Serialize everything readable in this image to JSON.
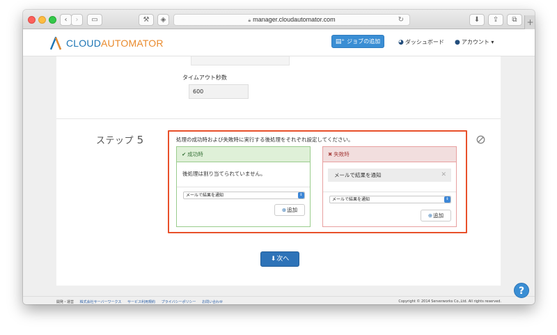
{
  "browser": {
    "url": "manager.cloudautomator.com"
  },
  "header": {
    "logo_part1": "CLOUD",
    "logo_part2": "AUTOMATOR",
    "add_job": "ジョブの追加",
    "dashboard": "ダッシュボード",
    "account": "アカウント ▾"
  },
  "form": {
    "timeout_label": "タイムアウト秒数",
    "timeout_value": "600"
  },
  "step": {
    "label_prefix": "ステップ",
    "label_number": "5",
    "description": "処理の成功時および失敗時に実行する後処理をそれぞれ設定してください。",
    "success": {
      "title": "成功時",
      "empty_text": "後処理は割り当てられていません。",
      "select_value": "メールで結果を通知",
      "add_label": "追加"
    },
    "failure": {
      "title": "失敗時",
      "assigned_item": "メールで結果を通知",
      "select_value": "メールで結果を通知",
      "add_label": "追加"
    }
  },
  "next_button": "次へ",
  "footer": {
    "dev_ops": "開発・運営",
    "company": "株式会社サーバーワークス",
    "terms": "サービス利用規約",
    "privacy": "プライバシーポリシー",
    "contact": "お問い合わせ",
    "copyright": "Copyright © 2014 Serverworks Co.,Ltd. All rights reserved."
  },
  "colors": {
    "accent_blue": "#3a8ed4",
    "highlight_red": "#e8502a",
    "success_green": "#3c763d",
    "failure_red": "#a94442"
  },
  "icons": {
    "add_job": "file-plus-icon",
    "dashboard": "tachometer-icon",
    "account": "user-icon",
    "step_disabled": "ban-icon",
    "success": "check-circle-icon",
    "failure": "x-icon",
    "add": "plus-circle-icon",
    "next": "arrow-circle-down-icon",
    "help": "question-icon"
  }
}
